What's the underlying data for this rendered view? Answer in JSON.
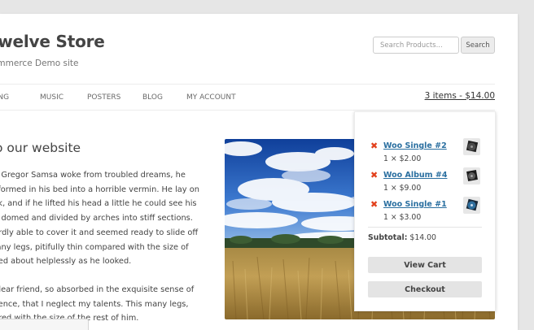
{
  "site": {
    "title": "Twelve Store",
    "description": "ommerce Demo site"
  },
  "search": {
    "placeholder": "Search Products...",
    "button_label": "Search"
  },
  "nav": {
    "items": [
      {
        "label": "HING"
      },
      {
        "label": "MUSIC"
      },
      {
        "label": "POSTERS"
      },
      {
        "label": "BLOG"
      },
      {
        "label": "MY ACCOUNT"
      }
    ],
    "cart_summary": "3 items - $14.00"
  },
  "entry": {
    "title": "o our website",
    "paragraphs": [
      [
        "en Gregor Samsa woke from troubled dreams, he",
        "nsformed in his bed into a horrible vermin. He lay on",
        "ack, and if he lifted his head a little he could see his",
        "tly domed and divided by arches into stiff sections.",
        "hardly able to cover it and seemed ready to slide off",
        "many legs, pitifully thin compared with the size of",
        "aved about helplessly as he looked."
      ],
      [
        "y dear friend, so absorbed in the exquisite sense of",
        "istence, that I neglect my talents. This many legs,",
        "pared with the size of the rest of him."
      ]
    ]
  },
  "mini_cart": {
    "remove_symbol": "✖",
    "items": [
      {
        "name": "Woo Single #2",
        "qty_price": "1 × $2.00"
      },
      {
        "name": "Woo Album #4",
        "qty_price": "1 × $9.00"
      },
      {
        "name": "Woo Single #1",
        "qty_price": "1 × $3.00"
      }
    ],
    "subtotal_label": "Subtotal:",
    "subtotal_value": "$14.00",
    "view_cart_label": "View Cart",
    "checkout_label": "Checkout"
  },
  "colors": {
    "link": "#2a6fa0",
    "remove": "#e2401c",
    "page_bg": "#e6e6e6"
  }
}
